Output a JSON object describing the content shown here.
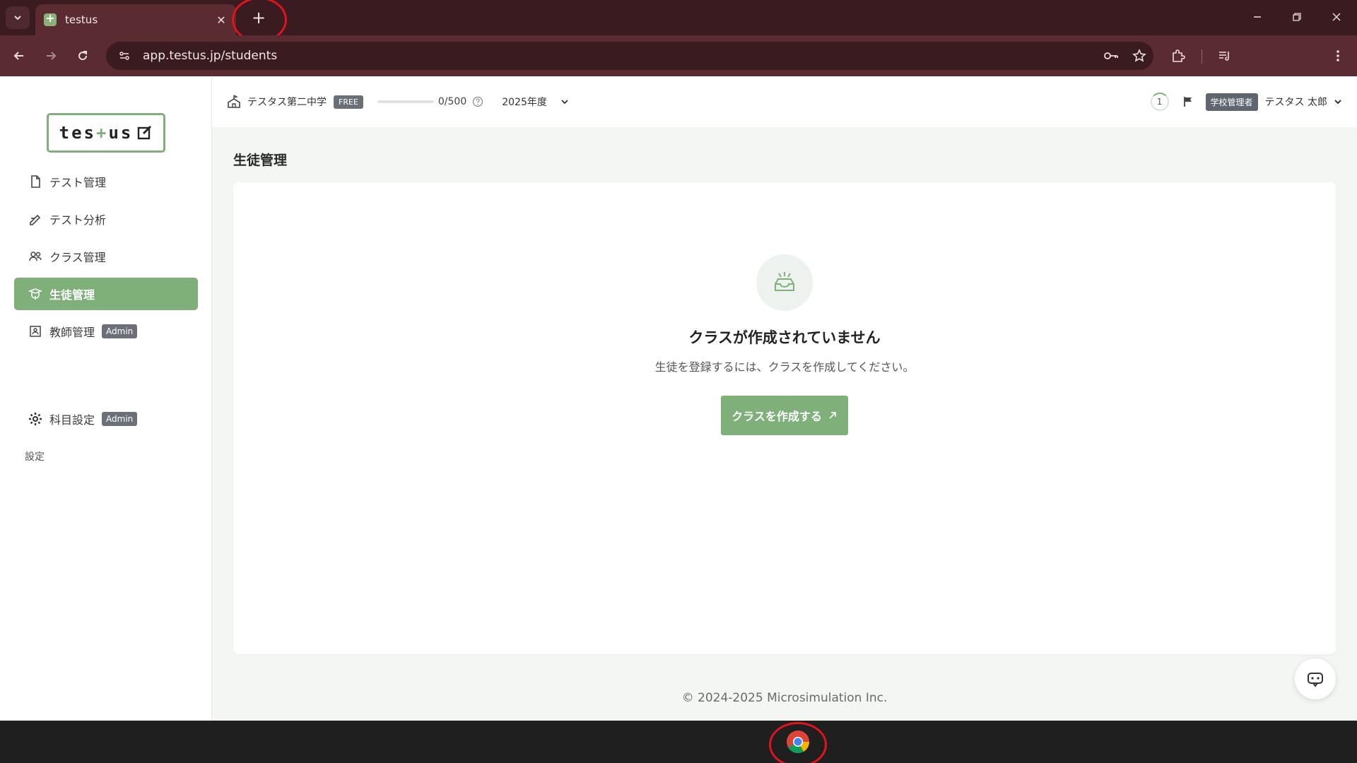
{
  "browser": {
    "tab_title": "testus",
    "url": "app.testus.jp/students"
  },
  "logo": {
    "part1": "tes",
    "plus": "+",
    "part2": "us"
  },
  "sidebar": {
    "items": [
      {
        "label": "テスト管理",
        "icon": "document-icon"
      },
      {
        "label": "テスト分析",
        "icon": "pen-analysis-icon"
      },
      {
        "label": "クラス管理",
        "icon": "group-icon"
      },
      {
        "label": "生徒管理",
        "icon": "student-icon",
        "active": true
      },
      {
        "label": "教師管理",
        "icon": "teacher-icon",
        "badge": "Admin"
      }
    ],
    "section_label": "設定",
    "settings_items": [
      {
        "label": "科目設定",
        "icon": "gear-icon",
        "badge": "Admin"
      }
    ]
  },
  "header": {
    "school_name": "テスタス第二中学",
    "plan_badge": "FREE",
    "usage": "0/500",
    "usage_fraction": 0,
    "year": "2025年度",
    "notification_count": "1",
    "role": "学校管理者",
    "user_name": "テスタス 太郎"
  },
  "main": {
    "page_title": "生徒管理",
    "empty_title": "クラスが作成されていません",
    "empty_description": "生徒を登録するには、クラスを作成してください。",
    "create_button": "クラスを作成する"
  },
  "footer": {
    "copyright": "© 2024-2025 Microsimulation Inc."
  },
  "colors": {
    "accent": "#7fb07a",
    "browser_frame": "#3a1b1f",
    "browser_toolbar": "#5a2b30",
    "annotation_circle": "#e0141c"
  }
}
